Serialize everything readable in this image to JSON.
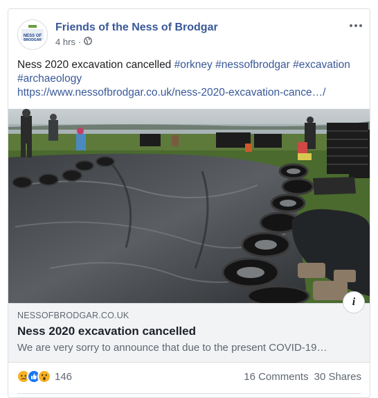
{
  "post": {
    "page_name": "Friends of the Ness of Brodgar",
    "time": "4 hrs",
    "time_separator": "·",
    "avatar_text": "NESS OF BRODGAR",
    "text_main": "Ness 2020 excavation cancelled ",
    "hashtags": [
      "#orkney",
      "#nessofbrodgar",
      "#excavation",
      "#archaeology"
    ],
    "link": "https://www.nessofbrodgar.co.uk/ness-2020-excavation-cance…/"
  },
  "preview": {
    "domain": "NESSOFBRODGAR.CO.UK",
    "headline": "Ness 2020 excavation cancelled",
    "description": "We are very sorry to announce that due to the present COVID-19…",
    "info_glyph": "i"
  },
  "footer": {
    "reaction_count": "146",
    "comments": "16 Comments",
    "shares": "30 Shares"
  },
  "icons": {
    "more": "more-horizontal-icon",
    "audience": "globe-icon",
    "reactions": [
      "sad-reaction-icon",
      "like-reaction-icon",
      "wow-reaction-icon"
    ]
  },
  "colors": {
    "link": "#385898",
    "meta": "#606770",
    "like": "#1877f2",
    "emoji": "#f7b125"
  }
}
